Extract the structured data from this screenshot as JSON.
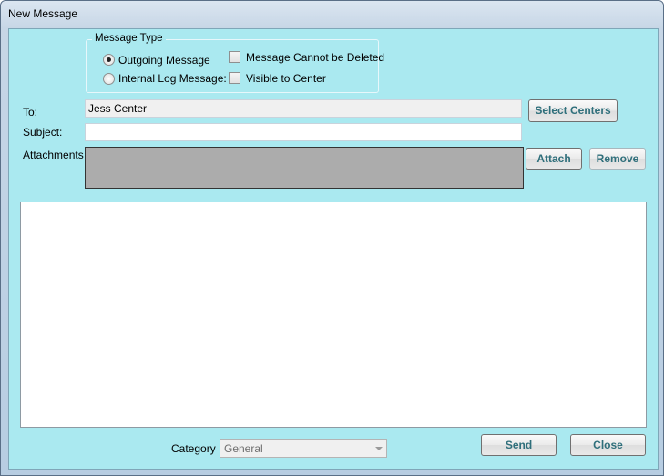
{
  "window": {
    "title": "New Message"
  },
  "message_type": {
    "legend": "Message Type",
    "options": [
      {
        "label": "Outgoing Message",
        "selected": true
      },
      {
        "label": "Internal Log Message:",
        "selected": false
      }
    ],
    "checkboxes": [
      {
        "label": "Message Cannot be Deleted",
        "checked": false
      },
      {
        "label": "Visible to Center",
        "checked": false
      }
    ]
  },
  "fields": {
    "to_label": "To:",
    "to_value": "Jess Center",
    "subject_label": "Subject:",
    "subject_value": "",
    "attachments_label": "Attachments"
  },
  "buttons": {
    "select_centers": "Select Centers",
    "attach": "Attach",
    "remove": "Remove",
    "send": "Send",
    "close": "Close"
  },
  "category": {
    "label": "Category",
    "selected": "General"
  },
  "colors": {
    "client_bg": "#aae9f0",
    "button_text": "#2f6f7b",
    "attachments_bg": "#acacac"
  }
}
